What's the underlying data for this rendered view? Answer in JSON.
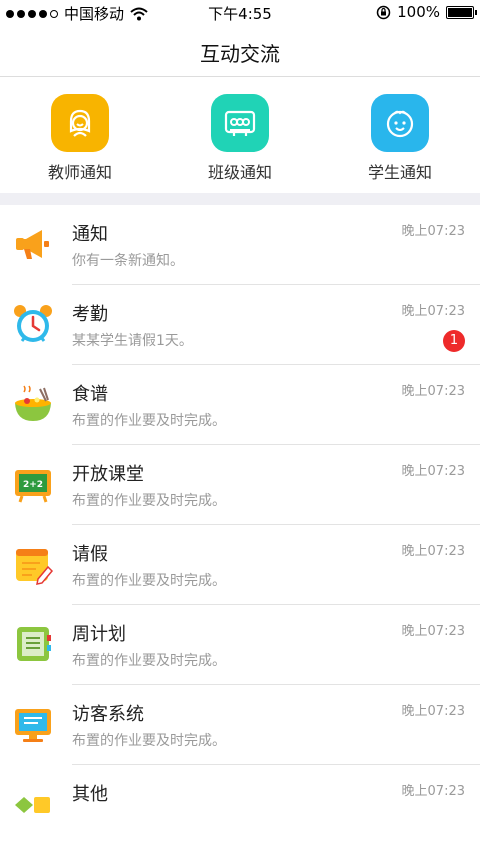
{
  "status": {
    "carrier": "中国移动",
    "time": "下午4:55",
    "battery": "100%"
  },
  "nav": {
    "title": "互动交流"
  },
  "quick": [
    {
      "label": "教师通知",
      "icon": "teacher-icon",
      "color": "#f8b400"
    },
    {
      "label": "班级通知",
      "icon": "class-icon",
      "color": "#20d3b6"
    },
    {
      "label": "学生通知",
      "icon": "student-icon",
      "color": "#29b6ec"
    }
  ],
  "list": [
    {
      "title": "通知",
      "subtitle": "你有一条新通知。",
      "time": "晚上07:23",
      "icon": "megaphone-icon"
    },
    {
      "title": "考勤",
      "subtitle": "某某学生请假1天。",
      "time": "晚上07:23",
      "icon": "alarm-clock-icon",
      "badge": "1"
    },
    {
      "title": "食谱",
      "subtitle": "布置的作业要及时完成。",
      "time": "晚上07:23",
      "icon": "food-bowl-icon"
    },
    {
      "title": "开放课堂",
      "subtitle": "布置的作业要及时完成。",
      "time": "晚上07:23",
      "icon": "blackboard-icon"
    },
    {
      "title": "请假",
      "subtitle": "布置的作业要及时完成。",
      "time": "晚上07:23",
      "icon": "note-pencil-icon"
    },
    {
      "title": "周计划",
      "subtitle": "布置的作业要及时完成。",
      "time": "晚上07:23",
      "icon": "notebook-icon"
    },
    {
      "title": "访客系统",
      "subtitle": "布置的作业要及时完成。",
      "time": "晚上07:23",
      "icon": "monitor-icon"
    },
    {
      "title": "其他",
      "subtitle": "",
      "time": "晚上07:23",
      "icon": "shapes-icon"
    }
  ]
}
